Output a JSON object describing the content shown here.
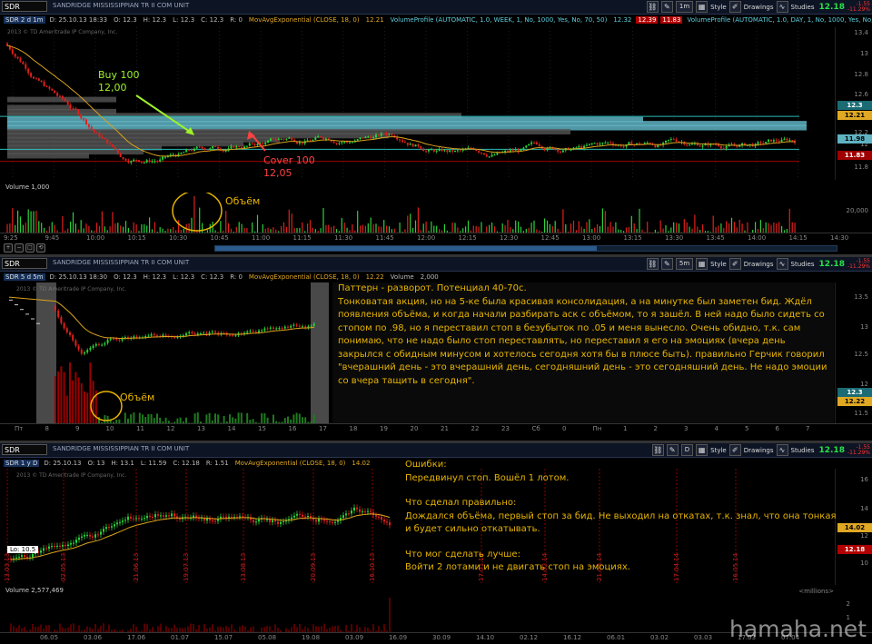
{
  "colors": {
    "up": "#2bd13a",
    "down": "#e0201b",
    "ema": "#d9a21b",
    "vp": "#5fb2c2",
    "annot_green": "#9ef22a",
    "annot_red": "#ff4141",
    "note": "#e8b500"
  },
  "panels": [
    {
      "symbol": "SDR",
      "description": "SANDRIDGE MISSISSIPPIAN TR II COM UNIT",
      "aggregation": "1m",
      "toolbar": {
        "style": "Style",
        "drawings": "Drawings",
        "studies": "Studies"
      },
      "last_price": "12.18",
      "change": "-1.55",
      "change_pct": "-11.29%",
      "studies": [
        {
          "text": "SDR 2 d 1m",
          "color": "#ddd",
          "bg": "#16305a"
        },
        {
          "text": "D: 25.10.13 18:33",
          "color": "#bbb"
        },
        {
          "text": "O: 12.3",
          "color": "#bbb"
        },
        {
          "text": "H: 12.3",
          "color": "#bbb"
        },
        {
          "text": "L: 12.3",
          "color": "#bbb"
        },
        {
          "text": "C: 12.3",
          "color": "#bbb"
        },
        {
          "text": "R: 0",
          "color": "#bbb"
        },
        {
          "text": "MovAvgExponential (CLOSE, 18, 0)",
          "color": "#e0a823"
        },
        {
          "text": "12.21",
          "color": "#e0a823"
        },
        {
          "text": "VolumeProfile (AUTOMATIC, 1.0, WEEK, 1, No, 1000, Yes, No, 70, 50)",
          "color": "#5fd0e0"
        },
        {
          "text": "12.32",
          "color": "#5fd0e0"
        },
        {
          "text": "12.39",
          "color": "#fff",
          "bg": "#b10000"
        },
        {
          "text": "11.83",
          "color": "#fff",
          "bg": "#b10000"
        },
        {
          "text": "VolumeProfile (AUTOMATIC, 1.0, DAY, 1, No, 1000, Yes, No, 70, 50)",
          "color": "#5fd0e0"
        }
      ],
      "copyright": "2013 © TD Ameritrade IP Company, Inc.",
      "price_ticks": [
        "13.4",
        "13",
        "12.8",
        "12.6",
        "12.4",
        "12.2",
        "12",
        "11.8"
      ],
      "price_tags": [
        {
          "text": "12.3",
          "color": "#fff",
          "bg": "#1b6b74"
        },
        {
          "text": "12.21",
          "color": "#000",
          "bg": "#e0a823"
        },
        {
          "text": "11.98",
          "color": "#000",
          "bg": "#5fb2c2"
        },
        {
          "text": "11.83",
          "color": "#fff",
          "bg": "#a00000"
        }
      ],
      "volume": {
        "label": "Volume",
        "value": "1,000",
        "ticks": [
          "20,000"
        ]
      },
      "annotations": {
        "buy_line1": "Buy 100",
        "buy_line2": "12,00",
        "cover_line1": "Cover 100",
        "cover_line2": "12,05",
        "volume_label": "Объём"
      },
      "time_ticks": [
        "9:25",
        "9:45",
        "10:00",
        "10:15",
        "10:30",
        "10:45",
        "11:00",
        "11:15",
        "11:30",
        "11:45",
        "12:00",
        "12:15",
        "12:30",
        "12:45",
        "13:00",
        "13:15",
        "13:30",
        "13:45",
        "14:00",
        "14:15",
        "14:30"
      ]
    },
    {
      "symbol": "SDR",
      "description": "SANDRIDGE MISSISSIPPIAN TR II COM UNIT",
      "aggregation": "5m",
      "toolbar": {
        "style": "Style",
        "drawings": "Drawings",
        "studies": "Studies"
      },
      "last_price": "12.18",
      "change": "-1.55",
      "change_pct": "-11.29%",
      "studies": [
        {
          "text": "SDR 5 d 5m",
          "color": "#ddd",
          "bg": "#16305a"
        },
        {
          "text": "D: 25.10.13 18:30",
          "color": "#bbb"
        },
        {
          "text": "O: 12.3",
          "color": "#bbb"
        },
        {
          "text": "H: 12.3",
          "color": "#bbb"
        },
        {
          "text": "L: 12.3",
          "color": "#bbb"
        },
        {
          "text": "C: 12.3",
          "color": "#bbb"
        },
        {
          "text": "R: 0",
          "color": "#bbb"
        },
        {
          "text": "MovAvgExponential (CLOSE, 18, 0)",
          "color": "#e0a823"
        },
        {
          "text": "12.22",
          "color": "#e0a823"
        },
        {
          "text": "Volume",
          "color": "#bbb"
        },
        {
          "text": "2,000",
          "color": "#bbb"
        }
      ],
      "copyright": "2013 © TD Ameritrade IP Company, Inc.",
      "price_ticks": [
        "13.5",
        "13",
        "12.5",
        "12",
        "11.5"
      ],
      "price_tags": [
        {
          "text": "12.3",
          "color": "#fff",
          "bg": "#1b6b74"
        },
        {
          "text": "12.22",
          "color": "#000",
          "bg": "#e0a823"
        }
      ],
      "annotations": {
        "volume_label": "Объём"
      },
      "note": [
        "Паттерн - разворот. Потенциал 40-70с.",
        "Тонковатая акция, но на 5-ке была красивая консолидация, а на минутке был заметен бид. Ждёл появления объёма, и когда начали разбирать аск с объёмом, то я зашёл. В ней надо было сидеть со стопом по .98, но я переставил стоп в безубыток по .05 и меня вынесло. Очень обидно, т.к. сам понимаю, что не надо было стоп переставлять, но переставил я его на эмоциях (вчера день закрылся с обидным минусом и хотелось сегодня хотя бы в плюсе быть). правильно Герчик говорил \"вчерашний день - это вчерашний день, сегодняшний день - это сегодняшний день. Не надо эмоции со вчера тащить в сегодня\"."
      ],
      "time_ticks": [
        "Пт",
        "8",
        "9",
        "10",
        "11",
        "12",
        "13",
        "14",
        "15",
        "16",
        "17",
        "18",
        "19",
        "20",
        "21",
        "22",
        "23",
        "Сб",
        "0",
        "Пн",
        "1",
        "2",
        "3",
        "4",
        "5",
        "6",
        "7"
      ]
    },
    {
      "symbol": "SDR",
      "description": "SANDRIDGE MISSISSIPPIAN TR II COM UNIT",
      "aggregation": "D",
      "toolbar": {
        "style": "Style",
        "drawings": "Drawings",
        "studies": "Studies"
      },
      "last_price": "12.18",
      "change": "-1.55",
      "change_pct": "-11.29%",
      "studies": [
        {
          "text": "SDR 1 y D",
          "color": "#ddd",
          "bg": "#16305a"
        },
        {
          "text": "D: 25.10.13",
          "color": "#bbb"
        },
        {
          "text": "O: 13",
          "color": "#bbb"
        },
        {
          "text": "H: 13.1",
          "color": "#bbb"
        },
        {
          "text": "L: 11.59",
          "color": "#bbb"
        },
        {
          "text": "C: 12.18",
          "color": "#bbb"
        },
        {
          "text": "R: 1.51",
          "color": "#bbb"
        },
        {
          "text": "MovAvgExponential (CLOSE, 18, 0)",
          "color": "#e0a823"
        },
        {
          "text": "14.02",
          "color": "#e0a823"
        }
      ],
      "copyright": "2013 © TD Ameritrade IP Company, Inc.",
      "price_ticks": [
        "16",
        "14",
        "12",
        "10"
      ],
      "price_tags": [
        {
          "text": "14.02",
          "color": "#000",
          "bg": "#e0a823"
        },
        {
          "text": "12.18",
          "color": "#fff",
          "bg": "#b10000"
        }
      ],
      "low_label": "Lo: 10.5",
      "notes": {
        "errors_title": "Ошибки:",
        "errors": "Передвинул стоп. Вошёл 1 лотом.",
        "right_title": "Что сделал правильно:",
        "right": "Дождался объёма, первый стоп за бид. Не выходил на откатах, т.к. знал, что она тонкая и будет сильно откатывать.",
        "better_title": "Что мог сделать лучше:",
        "better": "Войти 2 лотами и не двигать стоп на эмоциях."
      },
      "date_markers": [
        "13.03.13",
        "02.05.13",
        "21.06.13",
        "19.07.13",
        "13.08.13",
        "20.09.13",
        "16.10.13",
        "17.01.14",
        "14.02.14",
        "21.03.14",
        "17.04.14",
        "16.05.14"
      ],
      "volume": {
        "label": "Volume",
        "value": "2,577,469",
        "unit": "<millions>",
        "ticks": [
          "2",
          "1"
        ]
      },
      "time_ticks": [
        "06.05",
        "03.06",
        "17.06",
        "01.07",
        "15.07",
        "05.08",
        "19.08",
        "03.09",
        "16.09",
        "30.09",
        "14.10",
        "02.12",
        "16.12",
        "06.01",
        "03.02",
        "03.03",
        "17.03",
        "07.04"
      ]
    }
  ],
  "watermark": "hamaha.net"
}
